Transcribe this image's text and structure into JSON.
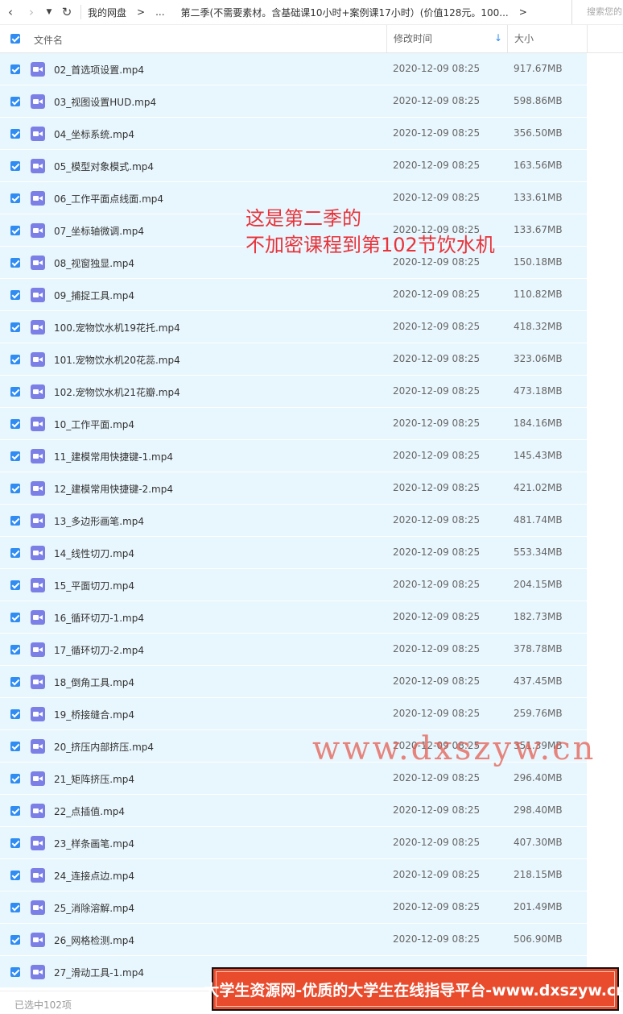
{
  "toolbar": {
    "back_icon": "chevron-left",
    "forward_icon": "chevron-right",
    "history_icon": "caret-down",
    "refresh_icon": "refresh",
    "breadcrumb_root": "我的网盘",
    "breadcrumb_sep1": ">",
    "breadcrumb_ellipsis": "...",
    "breadcrumb_current": "第二季(不需要素材。含基础课10小时+案例课17小时）(价值128元。100...",
    "breadcrumb_sep2": ">",
    "search_placeholder": "搜索您的"
  },
  "header": {
    "name_label": "文件名",
    "date_label": "修改时间",
    "size_label": "大小",
    "sort_icon": "arrow-down"
  },
  "files": [
    {
      "name": "02_首选项设置.mp4",
      "date": "2020-12-09 08:25",
      "size": "917.67MB"
    },
    {
      "name": "03_视图设置HUD.mp4",
      "date": "2020-12-09 08:25",
      "size": "598.86MB"
    },
    {
      "name": "04_坐标系统.mp4",
      "date": "2020-12-09 08:25",
      "size": "356.50MB"
    },
    {
      "name": "05_模型对象模式.mp4",
      "date": "2020-12-09 08:25",
      "size": "163.56MB"
    },
    {
      "name": "06_工作平面点线面.mp4",
      "date": "2020-12-09 08:25",
      "size": "133.61MB"
    },
    {
      "name": "07_坐标轴微调.mp4",
      "date": "2020-12-09 08:25",
      "size": "133.67MB"
    },
    {
      "name": "08_视窗独显.mp4",
      "date": "2020-12-09 08:25",
      "size": "150.18MB"
    },
    {
      "name": "09_捕捉工具.mp4",
      "date": "2020-12-09 08:25",
      "size": "110.82MB"
    },
    {
      "name": "100.宠物饮水机19花托.mp4",
      "date": "2020-12-09 08:25",
      "size": "418.32MB"
    },
    {
      "name": "101.宠物饮水机20花蕊.mp4",
      "date": "2020-12-09 08:25",
      "size": "323.06MB"
    },
    {
      "name": "102.宠物饮水机21花瓣.mp4",
      "date": "2020-12-09 08:25",
      "size": "473.18MB"
    },
    {
      "name": "10_工作平面.mp4",
      "date": "2020-12-09 08:25",
      "size": "184.16MB"
    },
    {
      "name": "11_建模常用快捷键-1.mp4",
      "date": "2020-12-09 08:25",
      "size": "145.43MB"
    },
    {
      "name": "12_建模常用快捷键-2.mp4",
      "date": "2020-12-09 08:25",
      "size": "421.02MB"
    },
    {
      "name": "13_多边形画笔.mp4",
      "date": "2020-12-09 08:25",
      "size": "481.74MB"
    },
    {
      "name": "14_线性切刀.mp4",
      "date": "2020-12-09 08:25",
      "size": "553.34MB"
    },
    {
      "name": "15_平面切刀.mp4",
      "date": "2020-12-09 08:25",
      "size": "204.15MB"
    },
    {
      "name": "16_循环切刀-1.mp4",
      "date": "2020-12-09 08:25",
      "size": "182.73MB"
    },
    {
      "name": "17_循环切刀-2.mp4",
      "date": "2020-12-09 08:25",
      "size": "378.78MB"
    },
    {
      "name": "18_倒角工具.mp4",
      "date": "2020-12-09 08:25",
      "size": "437.45MB"
    },
    {
      "name": "19_桥接缝合.mp4",
      "date": "2020-12-09 08:25",
      "size": "259.76MB"
    },
    {
      "name": "20_挤压内部挤压.mp4",
      "date": "2020-12-09 08:25",
      "size": "351.39MB"
    },
    {
      "name": "21_矩阵挤压.mp4",
      "date": "2020-12-09 08:25",
      "size": "296.40MB"
    },
    {
      "name": "22_点插值.mp4",
      "date": "2020-12-09 08:25",
      "size": "298.40MB"
    },
    {
      "name": "23_样条画笔.mp4",
      "date": "2020-12-09 08:25",
      "size": "407.30MB"
    },
    {
      "name": "24_连接点边.mp4",
      "date": "2020-12-09 08:25",
      "size": "218.15MB"
    },
    {
      "name": "25_消除溶解.mp4",
      "date": "2020-12-09 08:25",
      "size": "201.49MB"
    },
    {
      "name": "26_网格检测.mp4",
      "date": "2020-12-09 08:25",
      "size": "506.90MB"
    },
    {
      "name": "27_滑动工具-1.mp4",
      "date": "",
      "size": ""
    }
  ],
  "footer": {
    "status": "已选中102项"
  },
  "overlays": {
    "annotation_line1": "这是第二季的",
    "annotation_line2": "不加密课程到第102节饮水机",
    "watermark": "www.dxszyw.cn",
    "banner": "大学生资源网-优质的大学生在线指导平台-www.dxszyw.cn"
  },
  "colors": {
    "accent": "#2f8cf2",
    "row_selected": "#e8f6fd",
    "video_icon": "#7b7fe6",
    "annotation": "#e8333a",
    "banner_bg": "#e94b2d"
  }
}
